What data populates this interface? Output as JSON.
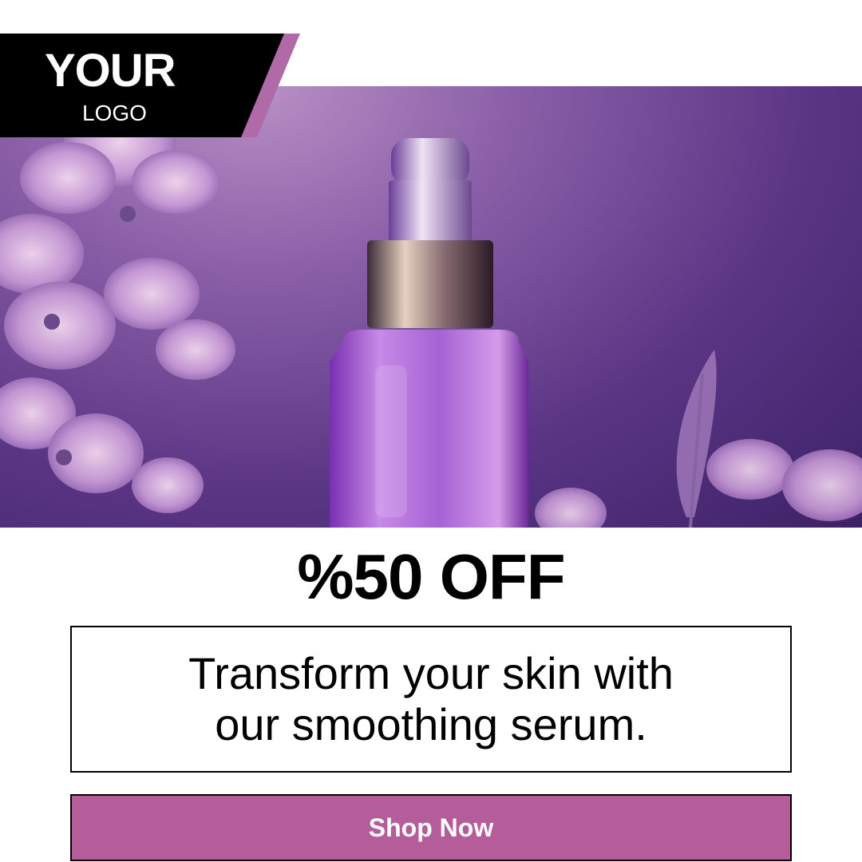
{
  "logo": {
    "main": "YOUR",
    "sub": "LOGO"
  },
  "promo": {
    "headline": "%50 OFF",
    "tagline": "Transform your skin with our smoothing serum."
  },
  "cta": {
    "label": "Shop Now"
  },
  "colors": {
    "accent": "#b55d9b",
    "logo_band": "#000000",
    "logo_stripe": "#b06aa8",
    "hero_dark": "#3d2168",
    "hero_light": "#b88fc4"
  },
  "hero": {
    "image": "purple serum bottle with lavender flowers"
  }
}
